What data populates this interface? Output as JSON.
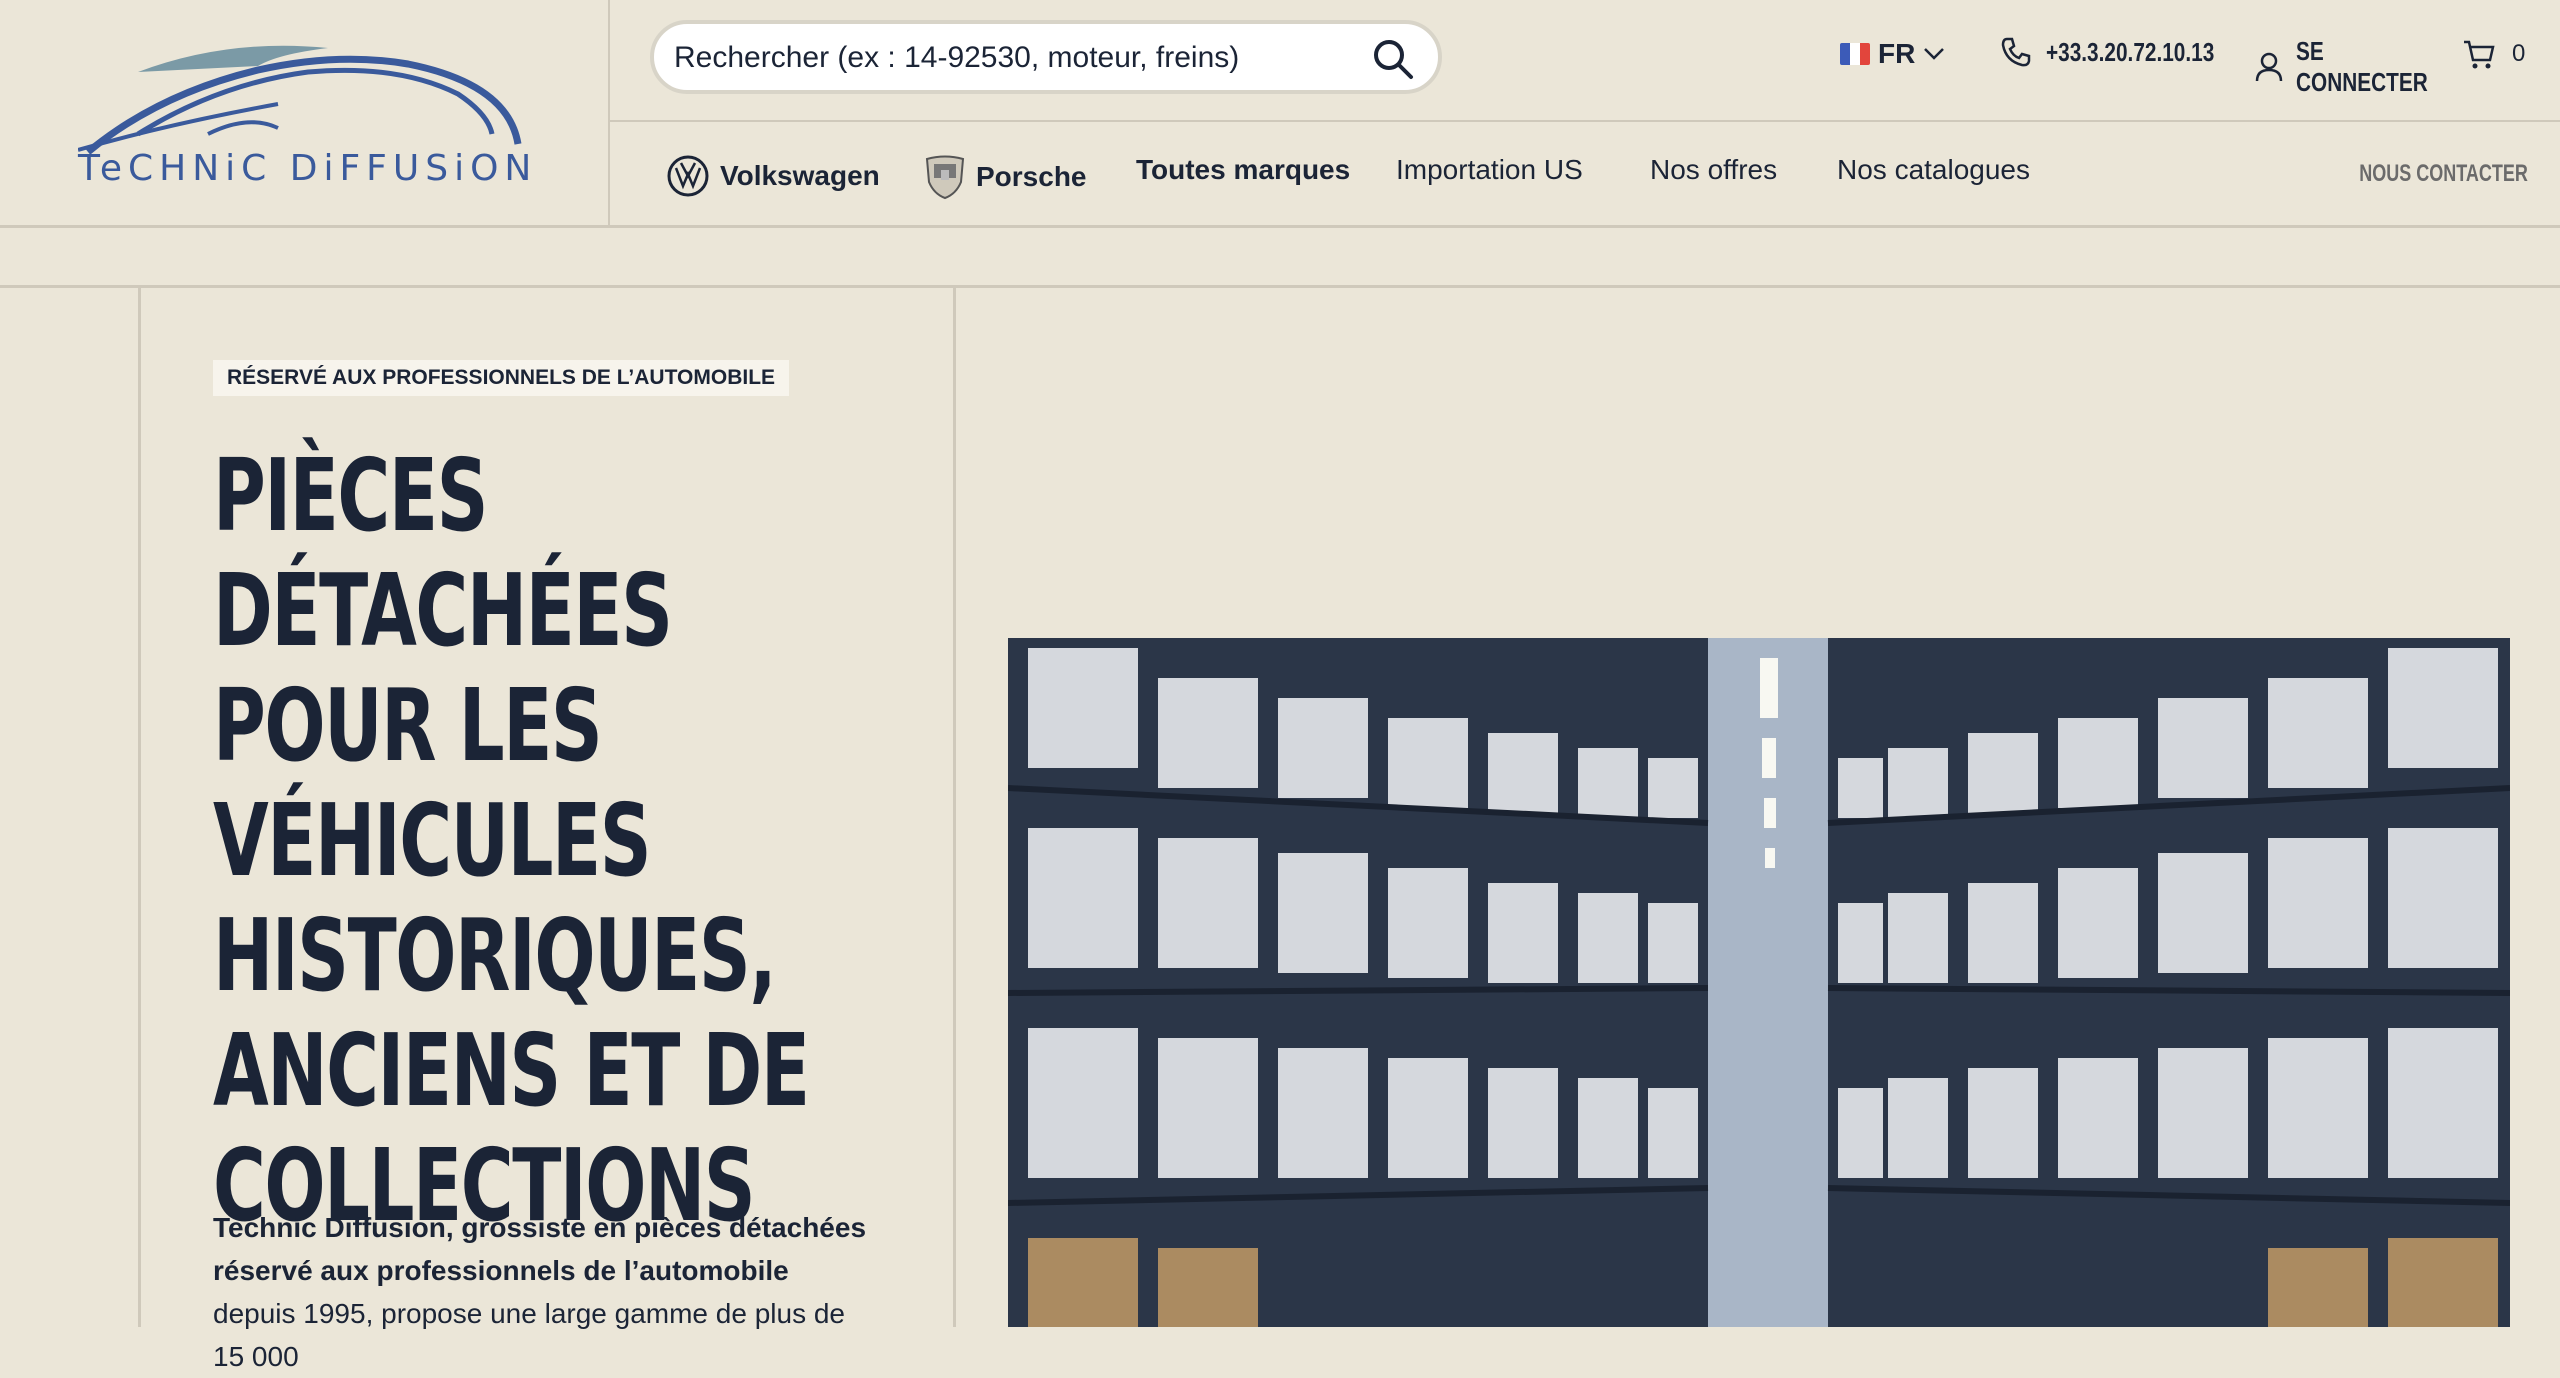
{
  "brand": {
    "name": "Technic Diffusion",
    "logo_text": "TeCHNiC DiFFUSiON",
    "logo_color": "#3a5a9c"
  },
  "search": {
    "placeholder": "Rechercher (ex : 14-92530, moteur, freins)",
    "icon": "search-icon"
  },
  "topbar": {
    "language": "FR",
    "phone": "+33.3.20.72.10.13",
    "login_label": "SE CONNECTER",
    "cart_count": "0"
  },
  "nav": {
    "items": [
      {
        "label": "Volkswagen",
        "icon": "volkswagen-logo-icon"
      },
      {
        "label": "Porsche",
        "icon": "porsche-crest-icon"
      },
      {
        "label": "Toutes marques"
      },
      {
        "label": "Importation US"
      },
      {
        "label": "Nos offres"
      },
      {
        "label": "Nos catalogues"
      }
    ],
    "contact_label": "NOUS CONTACTER"
  },
  "hero": {
    "badge": "RÉSERVÉ AUX PROFESSIONNELS DE L’AUTOMOBILE",
    "headline": [
      "PIÈCES DÉTACHÉES",
      "POUR LES",
      "VÉHICULES",
      "HISTORIQUES,",
      "ANCIENS ET DE",
      "COLLECTIONS"
    ],
    "intro_bold": "Technic Diffusion, grossiste en pièces détachées réservé aux professionnels de l’automobile",
    "intro_rest": " depuis 1995, propose une large gamme de plus de 15 000"
  },
  "colors": {
    "background": "#ebe6d8",
    "text": "#1b2436",
    "border": "#cfc9bb"
  }
}
